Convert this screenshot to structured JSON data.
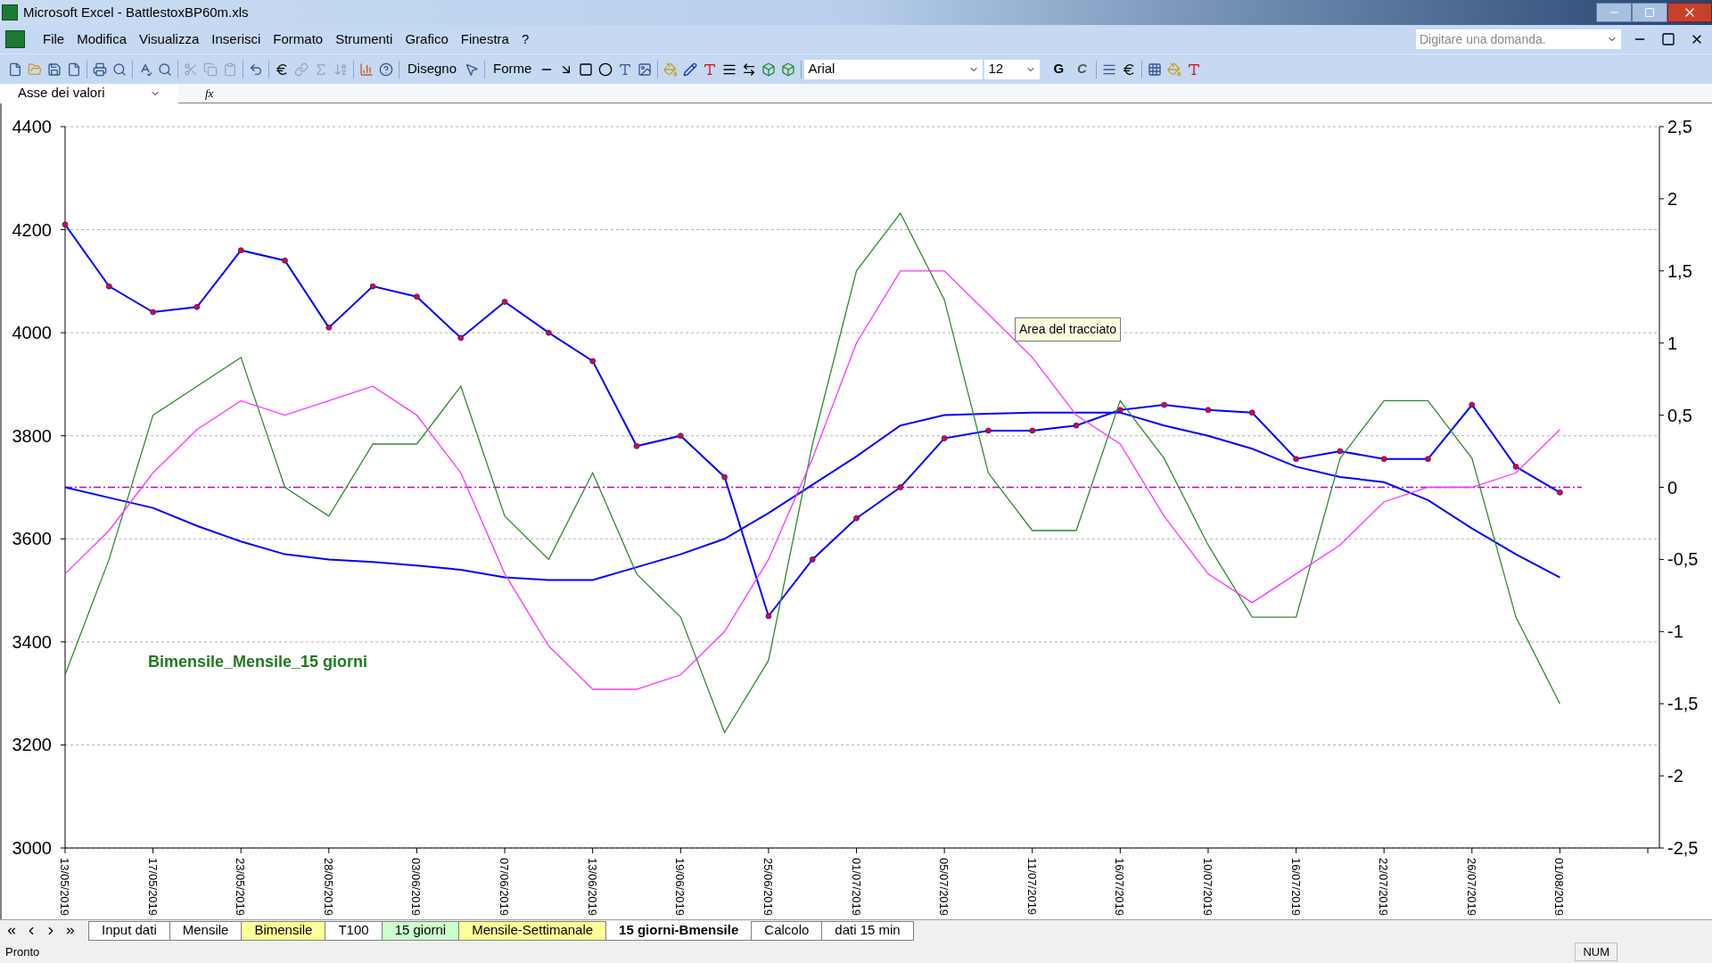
{
  "window": {
    "title": "Microsoft Excel - BattlestoxBP60m.xls"
  },
  "menu": [
    "File",
    "Modifica",
    "Visualizza",
    "Inserisci",
    "Formato",
    "Strumenti",
    "Grafico",
    "Finestra",
    "?"
  ],
  "help_search": {
    "placeholder": "Digitare una domanda."
  },
  "toolbar": {
    "drawing_menu": "Disegno",
    "shapes_menu": "Forme",
    "font": "Arial",
    "font_size": "12",
    "bold": "G",
    "italic": "C"
  },
  "formula_bar": {
    "name_box": "Asse dei valori",
    "fx": "fx"
  },
  "chart": {
    "tooltip": "Area del tracciato",
    "chart_data": {
      "type": "line",
      "grid": true,
      "annotations": [
        "Bimensile_Mensile_15 giorni"
      ],
      "ylim": [
        3000,
        4400
      ],
      "yticks": [
        3000,
        3200,
        3400,
        3600,
        3800,
        4000,
        4200,
        4400
      ],
      "y2lim": [
        -2.5,
        2.5
      ],
      "y2ticks": [
        {
          "value": -2.5,
          "label": "-2,5"
        },
        {
          "value": -2,
          "label": "-2"
        },
        {
          "value": -1.5,
          "label": "-1,5"
        },
        {
          "value": -1,
          "label": "-1"
        },
        {
          "value": -0.5,
          "label": "-0,5"
        },
        {
          "value": 0,
          "label": "0"
        },
        {
          "value": 0.5,
          "label": "0,5"
        },
        {
          "value": 1,
          "label": "1"
        },
        {
          "value": 1.5,
          "label": "1,5"
        },
        {
          "value": 2,
          "label": "2"
        },
        {
          "value": 2.5,
          "label": "2,5"
        }
      ],
      "ref_lines": [
        {
          "axis": "y2",
          "value": 0,
          "color": "#cc00cc"
        }
      ],
      "categories": [
        "13/05/2019",
        null,
        "17/05/2019",
        null,
        "23/05/2019",
        null,
        "28/05/2019",
        null,
        "03/06/2019",
        null,
        "07/06/2019",
        null,
        "13/06/2019",
        null,
        "19/06/2019",
        null,
        "25/06/2019",
        null,
        "01/07/2019",
        null,
        "05/07/2019",
        null,
        "11/07/2019",
        null,
        "16/07/2019",
        null,
        "10/07/2019",
        null,
        "16/07/2019",
        null,
        "22/07/2019",
        null,
        "26/07/2019",
        null,
        "01/08/2019"
      ],
      "series": [
        {
          "color": "#0000ff",
          "marker": true,
          "values": [
            4210,
            4090,
            4040,
            4050,
            4160,
            4140,
            4010,
            4090,
            4070,
            3990,
            4060,
            4000,
            3945,
            3780,
            3800,
            3720,
            3450,
            3560,
            3640,
            3700,
            3795,
            3810,
            3810,
            3820,
            3850,
            3860,
            3850,
            3845,
            3755,
            3770,
            3755,
            3755,
            3860,
            3740,
            3690
          ]
        },
        {
          "color": "#0000ff",
          "values": [
            3700,
            3680,
            3660,
            3625,
            3595,
            3570,
            3560,
            3555,
            3548,
            3540,
            3525,
            3520,
            3520,
            3545,
            3570,
            3600,
            3650,
            3705,
            3760,
            3820,
            3840,
            3843,
            3845,
            3845,
            3845,
            3820,
            3800,
            3775,
            3740,
            3720,
            3710,
            3675,
            3620,
            3570,
            3525
          ]
        },
        {
          "color": "#2e8b2e",
          "axis": "y2",
          "values": [
            -1.3,
            -0.5,
            0.5,
            0.7,
            0.9,
            0,
            -0.2,
            0.3,
            0.3,
            0.7,
            -0.2,
            -0.5,
            0.1,
            -0.6,
            -0.9,
            -1.7,
            -1.2,
            0.3,
            1.5,
            1.9,
            1.3,
            0.1,
            -0.3,
            -0.3,
            0.6,
            0.2,
            -0.4,
            -0.9,
            -0.9,
            0.2,
            0.6,
            0.6,
            0.2,
            -0.9,
            -1.5
          ]
        },
        {
          "color": "#ff33ff",
          "axis": "y2",
          "values": [
            -0.6,
            -0.3,
            0.1,
            0.4,
            0.6,
            0.5,
            0.6,
            0.7,
            0.5,
            0.1,
            -0.6,
            -1.1,
            -1.4,
            -1.4,
            -1.3,
            -1,
            -0.5,
            0.2,
            1,
            1.5,
            1.5,
            1.2,
            0.9,
            0.5,
            0.3,
            -0.2,
            -0.6,
            -0.8,
            -0.6,
            -0.4,
            -0.1,
            0,
            0,
            0.1,
            0.4
          ]
        }
      ]
    }
  },
  "sheet_tabs": [
    {
      "label": "Input dati",
      "selected": false,
      "color": "#ffffff"
    },
    {
      "label": "Mensile",
      "selected": false,
      "color": "#ffffff"
    },
    {
      "label": "Bimensile",
      "selected": false,
      "color": "#ffff99"
    },
    {
      "label": "T100",
      "selected": false,
      "color": "#ffffff"
    },
    {
      "label": "15 giorni",
      "selected": false,
      "color": "#ccffcc"
    },
    {
      "label": "Mensile-Settimanale",
      "selected": false,
      "color": "#ffff99"
    },
    {
      "label": "15 giorni-Bmensile",
      "selected": true,
      "color": "#ffffff"
    },
    {
      "label": "Calcolo",
      "selected": false,
      "color": "#ffffff"
    },
    {
      "label": "dati 15 min",
      "selected": false,
      "color": "#ffffff"
    }
  ],
  "status_bar": {
    "status": "Pronto",
    "num": "NUM"
  }
}
